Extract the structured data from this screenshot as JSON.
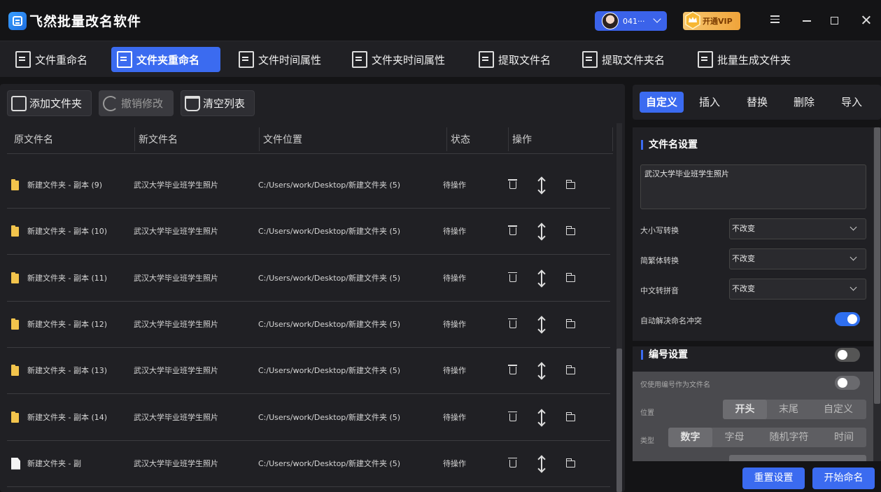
{
  "app": {
    "title": "飞然批量改名软件"
  },
  "header": {
    "user_name": "041···",
    "vip_label": "开通VIP"
  },
  "tabs": [
    {
      "label": "文件重命名",
      "active": false
    },
    {
      "label": "文件夹重命名",
      "active": true
    },
    {
      "label": "文件时间属性",
      "active": false
    },
    {
      "label": "文件夹时间属性",
      "active": false
    },
    {
      "label": "提取文件名",
      "active": false
    },
    {
      "label": "提取文件夹名",
      "active": false
    },
    {
      "label": "批量生成文件夹",
      "active": false
    }
  ],
  "toolbar": {
    "add_folder": "添加文件夹",
    "undo": "撤销修改",
    "clear": "清空列表"
  },
  "table": {
    "columns": [
      "原文件名",
      "新文件名",
      "文件位置",
      "状态",
      "操作"
    ],
    "rows": [
      {
        "original": "新建文件夹 - 副本 (9)",
        "new_name": "武汉大学毕业班学生照片",
        "location": "C:/Users/work/Desktop/新建文件夹 (5)",
        "status": "待操作",
        "icon": "folder-icon"
      },
      {
        "original": "新建文件夹 - 副本 (10)",
        "new_name": "武汉大学毕业班学生照片",
        "location": "C:/Users/work/Desktop/新建文件夹 (5)",
        "status": "待操作",
        "icon": "folder-icon"
      },
      {
        "original": "新建文件夹 - 副本 (11)",
        "new_name": "武汉大学毕业班学生照片",
        "location": "C:/Users/work/Desktop/新建文件夹 (5)",
        "status": "待操作",
        "icon": "folder-icon"
      },
      {
        "original": "新建文件夹 - 副本 (12)",
        "new_name": "武汉大学毕业班学生照片",
        "location": "C:/Users/work/Desktop/新建文件夹 (5)",
        "status": "待操作",
        "icon": "folder-icon"
      },
      {
        "original": "新建文件夹 - 副本 (13)",
        "new_name": "武汉大学毕业班学生照片",
        "location": "C:/Users/work/Desktop/新建文件夹 (5)",
        "status": "待操作",
        "icon": "folder-icon"
      },
      {
        "original": "新建文件夹 - 副本 (14)",
        "new_name": "武汉大学毕业班学生照片",
        "location": "C:/Users/work/Desktop/新建文件夹 (5)",
        "status": "待操作",
        "icon": "folder-icon"
      },
      {
        "original": "新建文件夹 - 副",
        "new_name": "武汉大学毕业班学生照片",
        "location": "C:/Users/work/Desktop/新建文件夹 (5)",
        "status": "待操作",
        "icon": "file-icon"
      }
    ]
  },
  "right_tabs": [
    {
      "label": "自定义",
      "active": true
    },
    {
      "label": "插入",
      "active": false
    },
    {
      "label": "替换",
      "active": false
    },
    {
      "label": "删除",
      "active": false
    },
    {
      "label": "导入",
      "active": false
    }
  ],
  "filename_settings": {
    "title": "文件名设置",
    "name_value": "武汉大学毕业班学生照片",
    "case_label": "大小写转换",
    "case_value": "不改变",
    "trad_label": "简繁体转换",
    "trad_value": "不改变",
    "pinyin_label": "中文转拼音",
    "pinyin_value": "不改变",
    "conflict_label": "自动解决命名冲突",
    "conflict_on": true
  },
  "numbering": {
    "title": "编号设置",
    "enabled": false,
    "only_number_label": "仅使用编号作为文件名",
    "only_number_on": false,
    "position_label": "位置",
    "positions": [
      "开头",
      "末尾",
      "自定义"
    ],
    "position_selected": 0,
    "type_label": "类型",
    "types": [
      "数字",
      "字母",
      "随机字符",
      "时间"
    ],
    "type_selected": 0
  },
  "actions": {
    "reset": "重置设置",
    "start": "开始命名"
  },
  "colors": {
    "accent": "#3b6bf0",
    "folder": "#f2c44c",
    "vip": "#f0a43a"
  }
}
